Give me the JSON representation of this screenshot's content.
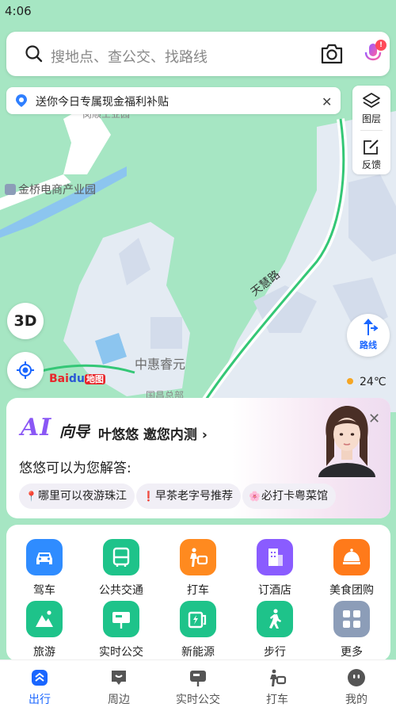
{
  "status_bar": {
    "time": "4:06"
  },
  "search": {
    "placeholder": "搜地点、查公交、找路线",
    "mic_badge": "!"
  },
  "promo": {
    "text": "送你今日专属现金福利补贴"
  },
  "side_panel": {
    "layers_label": "图层",
    "feedback_label": "反馈"
  },
  "map": {
    "btn_3d": "3D",
    "route_label": "路线",
    "labels": {
      "park": "金桥电商产业园",
      "community": "中惠睿元",
      "road": "天慧路",
      "top_poi": "岗顺工业园",
      "bottom_poi": "国昌总部"
    },
    "logo": {
      "text": "Bai",
      "paw": "du",
      "ditu": "地图"
    },
    "weather": "24℃"
  },
  "ai_card": {
    "logo": "AI",
    "xiangdao": "向导",
    "invite": "叶悠悠 邀您内测 ›",
    "subtitle": "悠悠可以为您解答:",
    "chips": [
      {
        "icon": "📍",
        "text": "哪里可以夜游珠江"
      },
      {
        "icon": "❗",
        "text": "早茶老字号推荐"
      },
      {
        "icon": "🌸",
        "text": "必打卡粤菜馆"
      }
    ]
  },
  "services": [
    {
      "label": "驾车",
      "icon": "car-icon",
      "color": "#2f8cff"
    },
    {
      "label": "公共交通",
      "icon": "bus-icon",
      "color": "#1ec38a"
    },
    {
      "label": "打车",
      "icon": "taxi-icon",
      "color": "#ff8a1f"
    },
    {
      "label": "订酒店",
      "icon": "hotel-icon",
      "color": "#8a5cff"
    },
    {
      "label": "美食团购",
      "icon": "food-icon",
      "color": "#ff7a1a"
    },
    {
      "label": "旅游",
      "icon": "travel-icon",
      "color": "#1ec38a"
    },
    {
      "label": "实时公交",
      "icon": "realtime-bus-icon",
      "color": "#1ec38a"
    },
    {
      "label": "新能源",
      "icon": "ev-icon",
      "color": "#1ec38a"
    },
    {
      "label": "步行",
      "icon": "walk-icon",
      "color": "#1ec38a"
    },
    {
      "label": "更多",
      "icon": "more-icon",
      "color": "#8c9db8"
    }
  ],
  "bottom_nav": [
    {
      "label": "出行",
      "active": true
    },
    {
      "label": "周边",
      "active": false
    },
    {
      "label": "实时公交",
      "active": false
    },
    {
      "label": "打车",
      "active": false
    },
    {
      "label": "我的",
      "active": false
    }
  ],
  "colors": {
    "accent": "#1a66ff",
    "map_green": "#a6e6c3"
  }
}
